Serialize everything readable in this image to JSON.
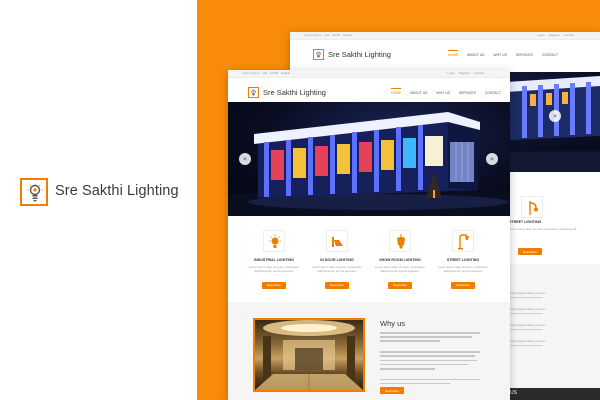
{
  "brand": {
    "name": "Sre Sakthi Lighting",
    "logo_icon": "bulb-logo-icon",
    "accent": "#f07d00",
    "background": "#f98b0a"
  },
  "site": {
    "name": "Sre Sakthi Lighting",
    "topbar": {
      "contact": "Lorem Ipsum · 123 · 12345 · Details",
      "links": [
        "Login",
        "Register",
        "Contact"
      ]
    },
    "nav": [
      {
        "label": "HOME",
        "active": true
      },
      {
        "label": "ABOUT US",
        "active": false
      },
      {
        "label": "WHY US",
        "active": false
      },
      {
        "label": "SERVICES",
        "active": false
      },
      {
        "label": "CONTACT",
        "active": false
      }
    ],
    "hero": {
      "prev_label": "«",
      "next_label": "»"
    },
    "services": [
      {
        "title": "INDUSTRIAL LIGHTING",
        "text": "Lorem ipsum dolor sit amet, consectetur adipiscing elit, sed do eiusmod.",
        "button": "Read More",
        "icon": "bulb-icon"
      },
      {
        "title": "IN DOOR LIGHTING",
        "text": "Lorem ipsum dolor sit amet, consectetur adipiscing elit, sed do eiusmod.",
        "button": "Read More",
        "icon": "wall-lamp-icon"
      },
      {
        "title": "SHOW ROOM LIGHTING",
        "text": "Lorem ipsum dolor sit amet, consectetur adipiscing elit, sed do eiusmod.",
        "button": "Read More",
        "icon": "ceiling-lamp-icon"
      },
      {
        "title": "STREET LIGHTING",
        "text": "Lorem ipsum dolor sit amet, consectetur adipiscing elit, sed do eiusmod.",
        "button": "Read More",
        "icon": "street-lamp-icon"
      }
    ],
    "why_us": {
      "title": "Why us",
      "button": "Read More"
    },
    "back_page": {
      "side_title": "STREET LIGHTING",
      "side_text": "Lorem ipsum dolor sit amet, consectetur adipiscing elit.",
      "side_button": "Read More",
      "list_items": [
        "Lorem ipsum dolor sit amet",
        "Lorem ipsum dolor sit amet",
        "Lorem ipsum dolor sit amet",
        "Lorem ipsum dolor sit amet"
      ],
      "footer_heading": "US"
    }
  }
}
